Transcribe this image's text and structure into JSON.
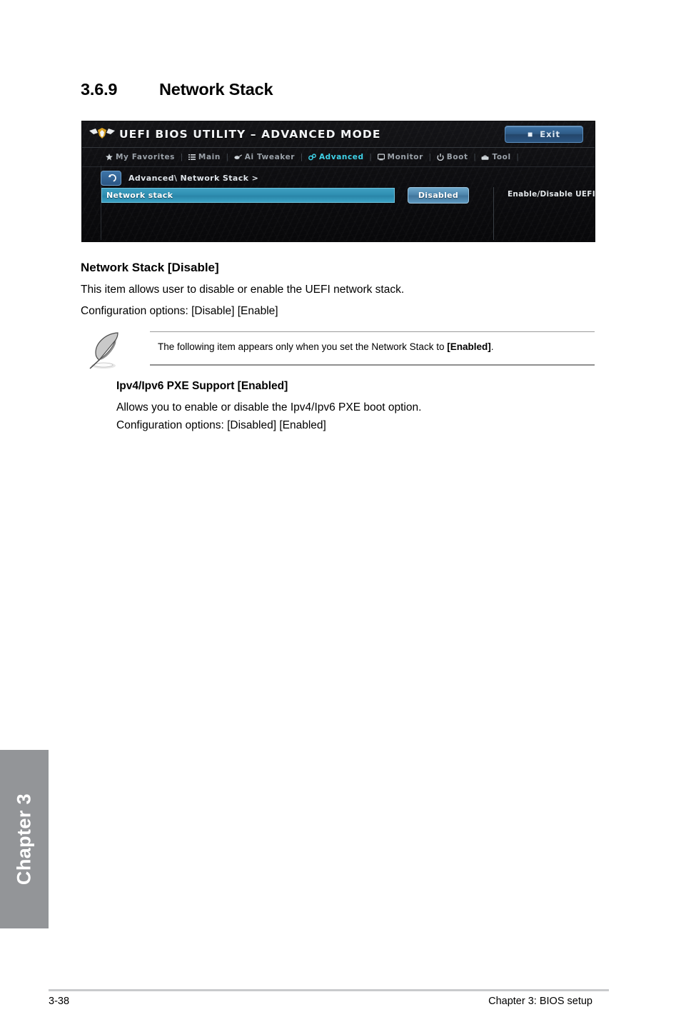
{
  "page": {
    "section_number": "3.6.9",
    "section_title": "Network Stack"
  },
  "bios_screenshot": {
    "title": "UEFI BIOS UTILITY – ADVANCED MODE",
    "logo_icon": "asus-eagle-logo-icon",
    "exit_button": {
      "label": "Exit",
      "icon": "exit-door-icon"
    },
    "tabs": [
      {
        "label": "My Favorites",
        "icon": "star-icon",
        "active": false
      },
      {
        "label": "Main",
        "icon": "list-icon",
        "active": false
      },
      {
        "label": "Ai Tweaker",
        "icon": "tweaker-icon",
        "active": false
      },
      {
        "label": "Advanced",
        "icon": "advanced-gear-icon",
        "active": true
      },
      {
        "label": "Monitor",
        "icon": "monitor-icon",
        "active": false
      },
      {
        "label": "Boot",
        "icon": "power-icon",
        "active": false
      },
      {
        "label": "Tool",
        "icon": "toolbox-icon",
        "active": false
      }
    ],
    "tab_separator": "|",
    "back_button_icon": "back-arrow-icon",
    "breadcrumb": "Advanced\\ Network Stack >",
    "option_row": {
      "label": "Network stack",
      "value": "Disabled"
    },
    "help_text": "Enable/Disable UEFI network stack",
    "colors": {
      "background": "#0a0a0c",
      "accent_cyan": "#3fd2e8",
      "highlight_row": "#2f8fb2",
      "button_blue": "#2e5a85"
    }
  },
  "body": {
    "item_title": "Network Stack [Disable]",
    "item_desc": "This item allows user to disable or enable the UEFI network stack.",
    "item_options": "Configuration options: [Disable] [Enable]"
  },
  "note": {
    "icon": "note-quill-pen-icon",
    "text_before": "The following item appears only when you set the Network Stack to ",
    "text_bold": "[Enabled]",
    "text_after": "."
  },
  "subitem": {
    "title": "Ipv4/Ipv6 PXE Support [Enabled]",
    "desc": "Allows you to enable or disable the Ipv4/Ipv6 PXE boot option.",
    "options": "Configuration options: [Disabled] [Enabled]"
  },
  "chapter_tab": {
    "label": "Chapter 3",
    "color": "#939598"
  },
  "footer": {
    "page_number": "3-38",
    "chapter_label": "Chapter 3: BIOS setup"
  }
}
